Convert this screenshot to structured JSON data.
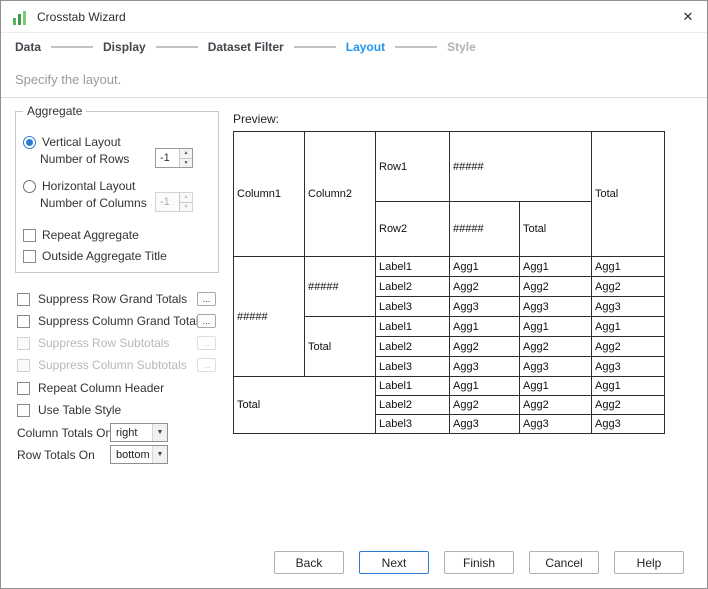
{
  "window": {
    "title": "Crosstab Wizard"
  },
  "icons": {
    "close": "✕",
    "spinner_up": "▲",
    "spinner_down": "▼",
    "dropdown_caret": "▼"
  },
  "colors": {
    "accent": "#2196f3",
    "icon_green": "#59b25c"
  },
  "steps": {
    "items": [
      {
        "label": "Data",
        "state": "normal"
      },
      {
        "label": "Display",
        "state": "normal"
      },
      {
        "label": "Dataset Filter",
        "state": "normal"
      },
      {
        "label": "Layout",
        "state": "active"
      },
      {
        "label": "Style",
        "state": "disabled"
      }
    ]
  },
  "subtitle": "Specify the layout.",
  "aggregate": {
    "legend": "Aggregate",
    "vertical": {
      "label": "Vertical Layout",
      "selected": true
    },
    "number_of_rows": {
      "label": "Number of Rows",
      "value": "-1"
    },
    "horizontal": {
      "label": "Horizontal Layout",
      "selected": false
    },
    "number_of_columns": {
      "label": "Number of Columns",
      "value": "-1",
      "disabled": true
    },
    "repeat_aggregate": {
      "label": "Repeat Aggregate",
      "checked": false
    },
    "outside_aggregate_title": {
      "label": "Outside Aggregate Title",
      "checked": false
    }
  },
  "options": {
    "more_label": "...",
    "suppress_row_grand_totals": {
      "label": "Suppress Row Grand Totals",
      "checked": false,
      "disabled": false
    },
    "suppress_column_grand_totals": {
      "label": "Suppress Column Grand Totals",
      "checked": false,
      "disabled": false
    },
    "suppress_row_subtotals": {
      "label": "Suppress Row Subtotals",
      "checked": false,
      "disabled": true
    },
    "suppress_column_subtotals": {
      "label": "Suppress Column Subtotals",
      "checked": false,
      "disabled": true
    },
    "repeat_column_header": {
      "label": "Repeat Column Header",
      "checked": false,
      "disabled": false
    },
    "use_table_style": {
      "label": "Use Table Style",
      "checked": false,
      "disabled": false
    }
  },
  "totals": {
    "column_totals_on": {
      "label": "Column Totals On",
      "value": "right"
    },
    "row_totals_on": {
      "label": "Row Totals On",
      "value": "bottom"
    }
  },
  "preview": {
    "label": "Preview:",
    "cells": {
      "column1": "Column1",
      "column2": "Column2",
      "row1": "Row1",
      "row1_value": "#####",
      "row2": "Row2",
      "row2_value": "#####",
      "col_total": "Total",
      "grand_col_total": "Total",
      "row_group_value": "#####",
      "sub_group_value": "#####",
      "sub_total": "Total",
      "grand_row_total": "Total",
      "label1": "Label1",
      "label2": "Label2",
      "label3": "Label3",
      "agg1": "Agg1",
      "agg2": "Agg2",
      "agg3": "Agg3"
    }
  },
  "footer": {
    "back": "Back",
    "next": "Next",
    "finish": "Finish",
    "cancel": "Cancel",
    "help": "Help"
  }
}
